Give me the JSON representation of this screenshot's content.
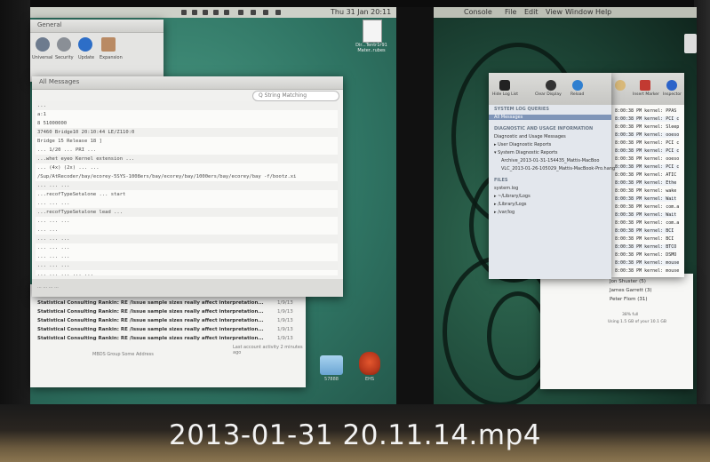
{
  "caption": "2013-01-31 20.11.14.mp4",
  "left_screen": {
    "menubar_clock": "Thu 31 Jan 20:11",
    "sysprefs_title": "General",
    "sysprefs_items": [
      "Universal",
      "Security",
      "Update",
      "Expansion"
    ],
    "log_window_title": "All Messages",
    "log_search_placeholder": "Q  String Matching",
    "log_lines": [
      "...  ",
      "a:1",
      "8  51000000",
      "37460 Bridge10 20:10:44 LE/Z110:0",
      "   Bridge 15 Release 18 ]",
      "   ...  1/20  ...  PRI  ...",
      "...whet eyeo Kernel extension ...",
      "...  (4x)  (2x)  ...  ...",
      "/Sup/AtRecoder/bay/ecorey-5SYS-1008ers/bay/ecorey/bay/1000ers/bay/ecorey/bay -f/bootz.xi",
      "...  ...  ...",
      "...recofTypeSetalone ...  start",
      "...  ...  ...",
      "...recofTypeSetalone lead ...",
      "...  ...  ...",
      "   ...  ...",
      "...  ...  ...",
      "...  ...  ...",
      "   ...  ...  ...",
      "   ...  ...  ...",
      "...  ...  ...  ...  ...",
      "   ...  ...  ...",
      "   ...  ...  ...  ...",
      "   ...  ...  ...  ...  ...  ...",
      "   ...  ...  ..."
    ],
    "log_status": "...  ...  ...  ...",
    "mail_rows": [
      {
        "subject": "Statistical Consulting Rankin: RE /Issue sample sizes really affect interpretation...",
        "num": "1/9/13"
      },
      {
        "subject": "Statistical Consulting Rankin: RE /Issue sample sizes really affect interpretation...",
        "num": "1/9/13"
      },
      {
        "subject": "Statistical Consulting Rankin: RE /Issue sample sizes really affect interpretation...",
        "num": "1/9/13"
      },
      {
        "subject": "Statistical Consulting Rankin: RE /Issue sample sizes really affect interpretation...",
        "num": "1/9/13"
      },
      {
        "subject": "Statistical Consulting Rankin: RE /Issue sample sizes really affect interpretation...",
        "num": "1/9/13"
      }
    ],
    "mail_footer_left": "MBDS Group  Some Address",
    "mail_footer_right": "Last account activity  2 minutes ago",
    "desktop_file_label": "Dir...Tentr1r91 Mater..rubes",
    "folder_label": "57888",
    "fox_label": "EHS"
  },
  "right_screen": {
    "menubar_items": [
      "Console",
      "File",
      "Edit",
      "View",
      "Window",
      "Help"
    ],
    "console_toolbar": [
      "Hide Log List",
      "Clear Display",
      "Reload",
      "Insert Marker",
      "Inspector"
    ],
    "sidebar": [
      {
        "label": "SYSTEM LOG QUERIES",
        "kind": "header"
      },
      {
        "label": "All Messages",
        "kind": "selected"
      },
      {
        "label": "DIAGNOSTIC AND USAGE INFORMATION",
        "kind": "header"
      },
      {
        "label": "Diagnostic and Usage Messages",
        "kind": "item"
      },
      {
        "label": "▸ User Diagnostic Reports",
        "kind": "item"
      },
      {
        "label": "▾ System Diagnostic Reports",
        "kind": "item"
      },
      {
        "label": "Archive_2013-01-31-154435_Mattis-MacBoo",
        "kind": "item"
      },
      {
        "label": "VLC_2013-01-26-105029_Mattis-MacBook-Pro.hang",
        "kind": "item"
      },
      {
        "label": "FILES",
        "kind": "header"
      },
      {
        "label": "system.log",
        "kind": "item"
      },
      {
        "label": "▸ ~/Library/Logs",
        "kind": "item"
      },
      {
        "label": "▸ /Library/Logs",
        "kind": "item"
      },
      {
        "label": "▸ /var/log",
        "kind": "item"
      }
    ],
    "log_entries": [
      "8:00:38 PM kernel: PPAS",
      "8:00:38 PM kernel: PCI c",
      "8:00:38 PM kernel: Sleep",
      "8:00:38 PM kernel: ooeso",
      "8:00:38 PM kernel: PCI c",
      "8:00:38 PM kernel: PCI c",
      "8:00:38 PM kernel: ooeso",
      "8:00:38 PM kernel: PCI c",
      "8:00:38 PM kernel: ATIC",
      "8:00:38 PM kernel: Ethe",
      "8:00:38 PM kernel: wake",
      "8:00:38 PM kernel: Wait",
      "8:00:38 PM kernel: com.a",
      "8:00:38 PM kernel: Wait",
      "8:00:38 PM kernel: com.a",
      "8:00:38 PM kernel: BCI",
      "8:00:38 PM kernel: BCI",
      "8:00:38 PM kernel: BTCO",
      "8:00:38 PM kernel: DSMO",
      "8:00:38 PM kernel: mouse",
      "8:00:38 PM kernel: mouse"
    ],
    "mail_names": [
      {
        "name": "Jon Shuster",
        "count": "(5)"
      },
      {
        "name": "James Garrett",
        "count": "(3)"
      },
      {
        "name": "Peter Flom",
        "count": "(31)"
      }
    ],
    "mail_meta": [
      "38% full",
      "Using 1.5 GB of your 10.1 GB"
    ]
  }
}
